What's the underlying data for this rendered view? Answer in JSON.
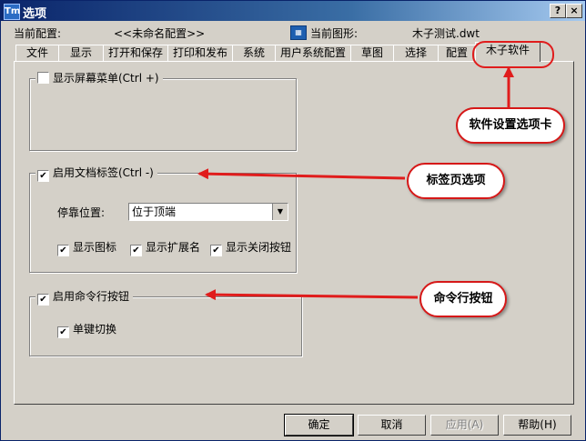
{
  "window": {
    "title": "选项",
    "help_btn": "?",
    "close_btn": "×",
    "app_icon_text": "Tm"
  },
  "header": {
    "current_profile_label": "当前配置:",
    "current_profile_value": "<<未命名配置>>",
    "current_drawing_label": "当前图形:",
    "current_drawing_value": "木子测试.dwt"
  },
  "tabs": [
    {
      "label": "文件"
    },
    {
      "label": "显示"
    },
    {
      "label": "打开和保存"
    },
    {
      "label": "打印和发布"
    },
    {
      "label": "系统"
    },
    {
      "label": "用户系统配置"
    },
    {
      "label": "草图"
    },
    {
      "label": "选择"
    },
    {
      "label": "配置"
    },
    {
      "label": "木子软件"
    }
  ],
  "active_tab": "木子软件",
  "group1": {
    "label": "显示屏幕菜单(Ctrl +)",
    "checked": false
  },
  "group2": {
    "label": "启用文档标签(Ctrl -)",
    "checked": true,
    "dock_label": "停靠位置:",
    "dock_value": "位于顶端",
    "options": [
      {
        "label": "显示图标",
        "checked": true
      },
      {
        "label": "显示扩展名",
        "checked": true
      },
      {
        "label": "显示关闭按钮",
        "checked": true
      }
    ]
  },
  "group3": {
    "label": "启用命令行按钮",
    "checked": true,
    "options": [
      {
        "label": "单键切换",
        "checked": true
      }
    ]
  },
  "buttons": {
    "ok": "确定",
    "cancel": "取消",
    "apply": "应用(A)",
    "help": "帮助(H)"
  },
  "annotations": {
    "tab_callout": "软件设置选项卡",
    "tabs_callout": "标签页选项",
    "cmd_callout": "命令行按钮"
  },
  "check_mark": "✔",
  "dropdown_arrow": "▼"
}
